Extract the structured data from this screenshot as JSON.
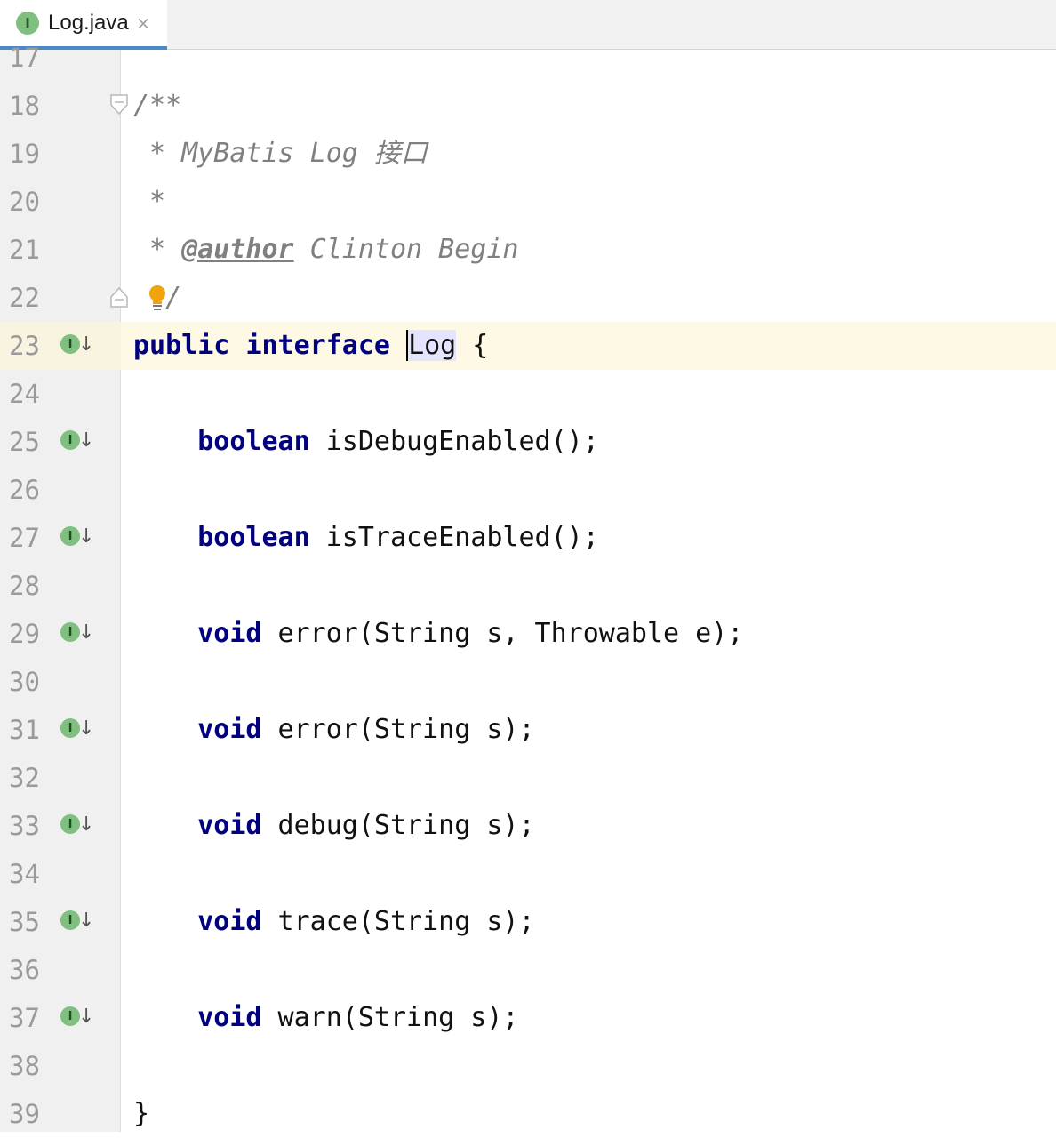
{
  "tab": {
    "title": "Log.java",
    "icon_letter": "I",
    "close_glyph": "×"
  },
  "lines": [
    {
      "n": "17"
    },
    {
      "n": "18",
      "comment": "/**"
    },
    {
      "n": "19",
      "comment": " * MyBatis Log 接口"
    },
    {
      "n": "20",
      "comment": " *"
    },
    {
      "n": "21",
      "comment_prefix": " * ",
      "tag": "@author",
      "comment_rest": " Clinton Begin"
    },
    {
      "n": "22",
      "comment": " */"
    },
    {
      "n": "23",
      "kw1": "public",
      "kw2": "interface",
      "ident": "Log",
      "rest": " {"
    },
    {
      "n": "24"
    },
    {
      "n": "25",
      "kw": "boolean",
      "rest": " isDebugEnabled();"
    },
    {
      "n": "26"
    },
    {
      "n": "27",
      "kw": "boolean",
      "rest": " isTraceEnabled();"
    },
    {
      "n": "28"
    },
    {
      "n": "29",
      "kw": "void",
      "rest": " error(String s, Throwable e);"
    },
    {
      "n": "30"
    },
    {
      "n": "31",
      "kw": "void",
      "rest": " error(String s);"
    },
    {
      "n": "32"
    },
    {
      "n": "33",
      "kw": "void",
      "rest": " debug(String s);"
    },
    {
      "n": "34"
    },
    {
      "n": "35",
      "kw": "void",
      "rest": " trace(String s);"
    },
    {
      "n": "36"
    },
    {
      "n": "37",
      "kw": "void",
      "rest": " warn(String s);"
    },
    {
      "n": "38"
    },
    {
      "n": "39",
      "rest": "}"
    }
  ],
  "gutter_icon": {
    "letter": "I",
    "arrow": "↓",
    "name": "implemented-by-icon"
  },
  "colors": {
    "keyword": "#000080",
    "comment": "#808080",
    "current_line": "#fdf9e4",
    "interface_icon": "#7fbf7f"
  }
}
